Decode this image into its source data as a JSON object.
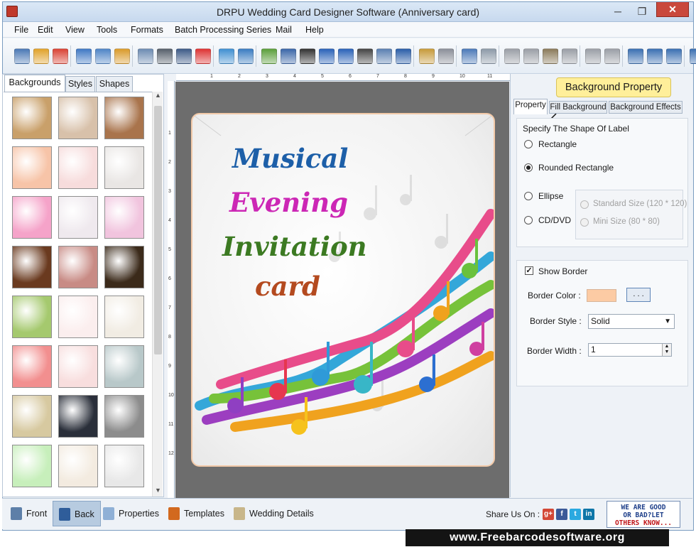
{
  "window": {
    "title": "DRPU Wedding Card Designer Software (Anniversary card)",
    "minimize": "─",
    "maximize": "❐",
    "close": "✕"
  },
  "menu": [
    "File",
    "Edit",
    "View",
    "Tools",
    "Formats",
    "Batch Processing Series",
    "Mail",
    "Help"
  ],
  "toolbar_icons": [
    "new-icon",
    "open-icon",
    "close-doc-icon",
    "save-icon",
    "save-as-icon",
    "export-icon",
    "properties-icon",
    "print-icon",
    "print-preview-icon",
    "gift-icon",
    "image-icon",
    "pen-icon",
    "shapes-icon",
    "barcode-linear-icon",
    "barcode-icon",
    "text-icon",
    "word-art-icon",
    "signature-icon",
    "mail-icon",
    "line-icon",
    "database-icon",
    "database-multi-icon",
    "undo-icon",
    "redo-icon",
    "cut-icon",
    "copy-icon",
    "paste-icon",
    "delete-icon",
    "bring-front-icon",
    "send-back-icon",
    "grid-icon",
    "actual-size-icon",
    "fit-icon",
    "zoom-icon"
  ],
  "left_panel": {
    "tabs": [
      "Backgrounds",
      "Styles",
      "Shapes"
    ],
    "active_tab": "Backgrounds",
    "thumbnail_colors": [
      [
        "#c9a06a",
        "#d8c1aa",
        "#a9744c"
      ],
      [
        "#f7c4a8",
        "#f7dcdc",
        "#e9e6e4"
      ],
      [
        "#f5a3c9",
        "#efe9ee",
        "#f1c4de"
      ],
      [
        "#6a3a1f",
        "#c88b85",
        "#3b2a1a"
      ],
      [
        "#a5c96e",
        "#fbeeee",
        "#f1ece3"
      ],
      [
        "#f28f8f",
        "#f8dede",
        "#b8c8c9"
      ],
      [
        "#d7c9a0",
        "#2a2f3a",
        "#8c8c8c"
      ],
      [
        "#c7efbb",
        "#f3ebe0",
        "#e8e8e8"
      ]
    ]
  },
  "ruler": {
    "h_numbers": [
      "1",
      "2",
      "3",
      "4",
      "5",
      "6",
      "7",
      "8",
      "9",
      "10",
      "11"
    ],
    "v_numbers": [
      "1",
      "2",
      "3",
      "4",
      "5",
      "6",
      "7",
      "8",
      "9",
      "10",
      "11",
      "12"
    ]
  },
  "card": {
    "lines": [
      {
        "text": "Musical",
        "color": "#1d5fa8"
      },
      {
        "text": "Evening",
        "color": "#cc27b5"
      },
      {
        "text": "Invitation",
        "color": "#3c7a22"
      },
      {
        "text": "card",
        "color": "#b44a1f"
      }
    ]
  },
  "right_panel": {
    "callout": "Background Property",
    "tabs": [
      "Property",
      "Fill Background",
      "Background Effects"
    ],
    "active_tab": "Property",
    "shape_group_label": "Specify The Shape Of Label",
    "shapes": [
      "Rectangle",
      "Rounded Rectangle",
      "Ellipse",
      "CD/DVD"
    ],
    "selected_shape": "Rounded Rectangle",
    "sizes": [
      "Standard Size (120 * 120)",
      "Mini Size (80 * 80)"
    ],
    "show_border_label": "Show Border",
    "show_border_checked": true,
    "check_mark": "✓",
    "border_color_label": "Border Color :",
    "border_color": "#fccba4",
    "border_color_button": ". . .",
    "border_style_label": "Border Style :",
    "border_style_value": "Solid",
    "border_width_label": "Border Width :",
    "border_width_value": "1"
  },
  "bottom_bar": {
    "buttons": [
      "Front",
      "Back",
      "Properties",
      "Templates",
      "Wedding Details"
    ],
    "active": "Back",
    "share_label": "Share Us On :",
    "social": [
      "g+",
      "f",
      "t",
      "in"
    ],
    "banner_lines": [
      "WE ARE GOOD",
      "OR BAD?LET",
      "OTHERS KNOW..."
    ]
  },
  "footer_url": "www.Freebarcodesoftware.org"
}
